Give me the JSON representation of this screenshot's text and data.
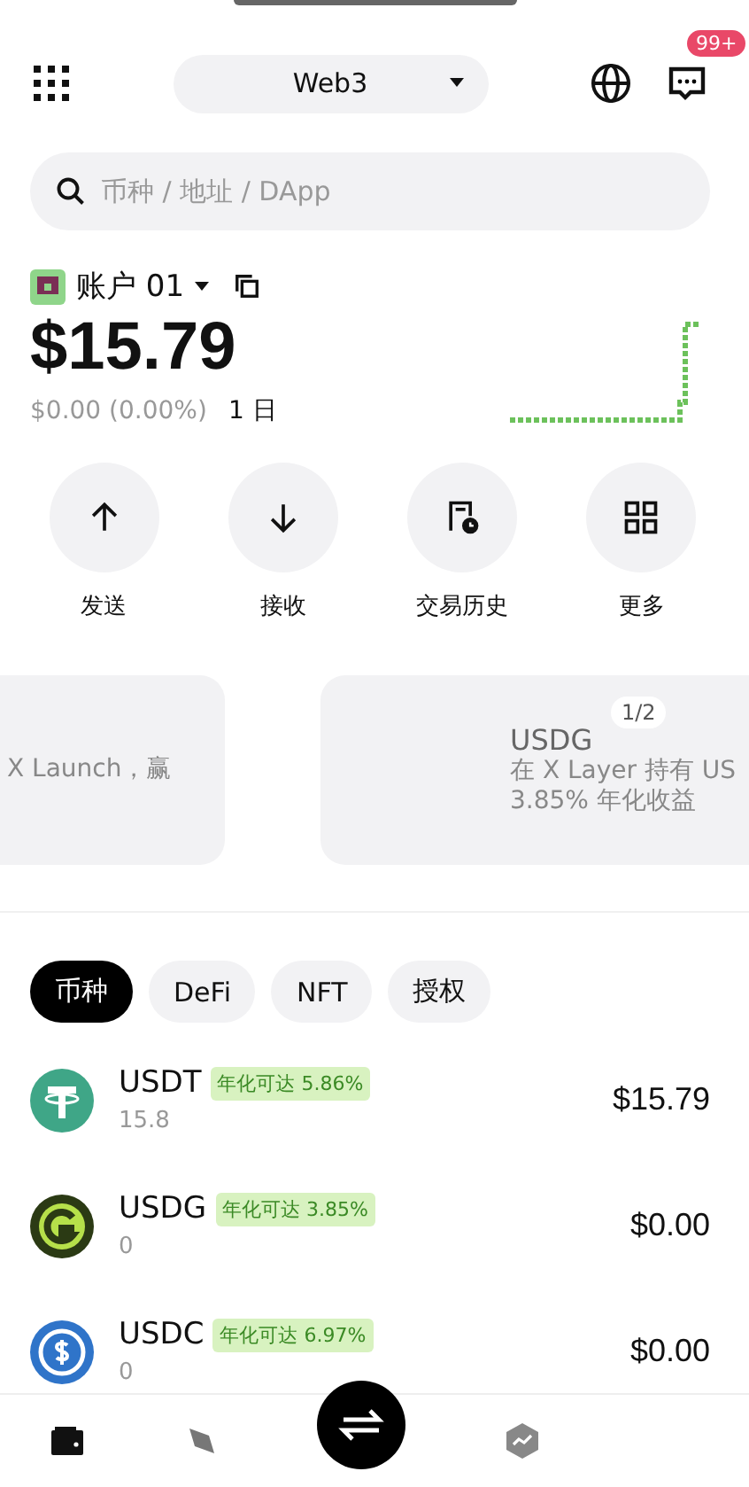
{
  "top_bar": {
    "mode": "Web3",
    "notification_badge": "99+"
  },
  "search": {
    "placeholder": "币种 / 地址 / DApp"
  },
  "account": {
    "name": "账户 01",
    "balance": "$15.79",
    "change": "$0.00 (0.00%)",
    "period": "1 日"
  },
  "actions": [
    {
      "label": "发送",
      "kind": "send"
    },
    {
      "label": "接收",
      "kind": "receive"
    },
    {
      "label": "交易历史",
      "kind": "history"
    },
    {
      "label": "更多",
      "kind": "more"
    }
  ],
  "banners": [
    {
      "lines": [
        "X Launch，赢"
      ]
    },
    {
      "title": "USDG",
      "lines": [
        "在 X Layer 持有 US",
        "3.85% 年化收益"
      ]
    }
  ],
  "banner_pager": "1/2",
  "tabs": [
    {
      "label": "币种",
      "selected": true
    },
    {
      "label": "DeFi",
      "selected": false
    },
    {
      "label": "NFT",
      "selected": false
    },
    {
      "label": "授权",
      "selected": false
    }
  ],
  "tokens": [
    {
      "symbol": "USDT",
      "tag": "年化可达 5.86%",
      "amount": "15.8",
      "value": "$15.79",
      "color": "#3fa687"
    },
    {
      "symbol": "USDG",
      "tag": "年化可达 3.85%",
      "amount": "0",
      "value": "$0.00",
      "color": "#2b3a14"
    },
    {
      "symbol": "USDC",
      "tag": "年化可达 6.97%",
      "amount": "0",
      "value": "$0.00",
      "color": "#2f74c9"
    }
  ],
  "bottom_nav": [
    {
      "kind": "wallet"
    },
    {
      "kind": "discover"
    },
    {
      "kind": "swap"
    },
    {
      "kind": "market"
    }
  ]
}
